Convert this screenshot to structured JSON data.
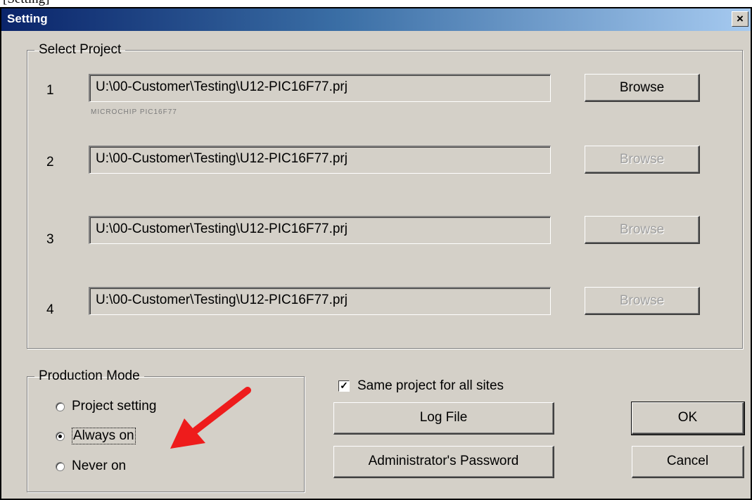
{
  "crop_text": "[Setting]",
  "window": {
    "title": "Setting",
    "close_glyph": "×"
  },
  "select_project": {
    "legend": "Select Project",
    "rows": [
      {
        "num": "1",
        "path": "U:\\00-Customer\\Testing\\U12-PIC16F77.prj",
        "device": "MICROCHIP PIC16F77",
        "browse": "Browse",
        "browse_enabled": true
      },
      {
        "num": "2",
        "path": "U:\\00-Customer\\Testing\\U12-PIC16F77.prj",
        "browse": "Browse",
        "browse_enabled": false
      },
      {
        "num": "3",
        "path": "U:\\00-Customer\\Testing\\U12-PIC16F77.prj",
        "browse": "Browse",
        "browse_enabled": false
      },
      {
        "num": "4",
        "path": "U:\\00-Customer\\Testing\\U12-PIC16F77.prj",
        "browse": "Browse",
        "browse_enabled": false
      }
    ]
  },
  "production_mode": {
    "legend": "Production Mode",
    "options": [
      "Project setting",
      "Always on",
      "Never on"
    ],
    "selected": "Always on"
  },
  "same_project": {
    "label": "Same project for all sites",
    "checked": true
  },
  "buttons": {
    "log_file": "Log File",
    "admin_password": "Administrator's Password",
    "ok": "OK",
    "cancel": "Cancel"
  },
  "colors": {
    "annotation_arrow": "#ee1c1c",
    "dialog_face": "#d4d0c8",
    "title_start": "#0a246a"
  }
}
